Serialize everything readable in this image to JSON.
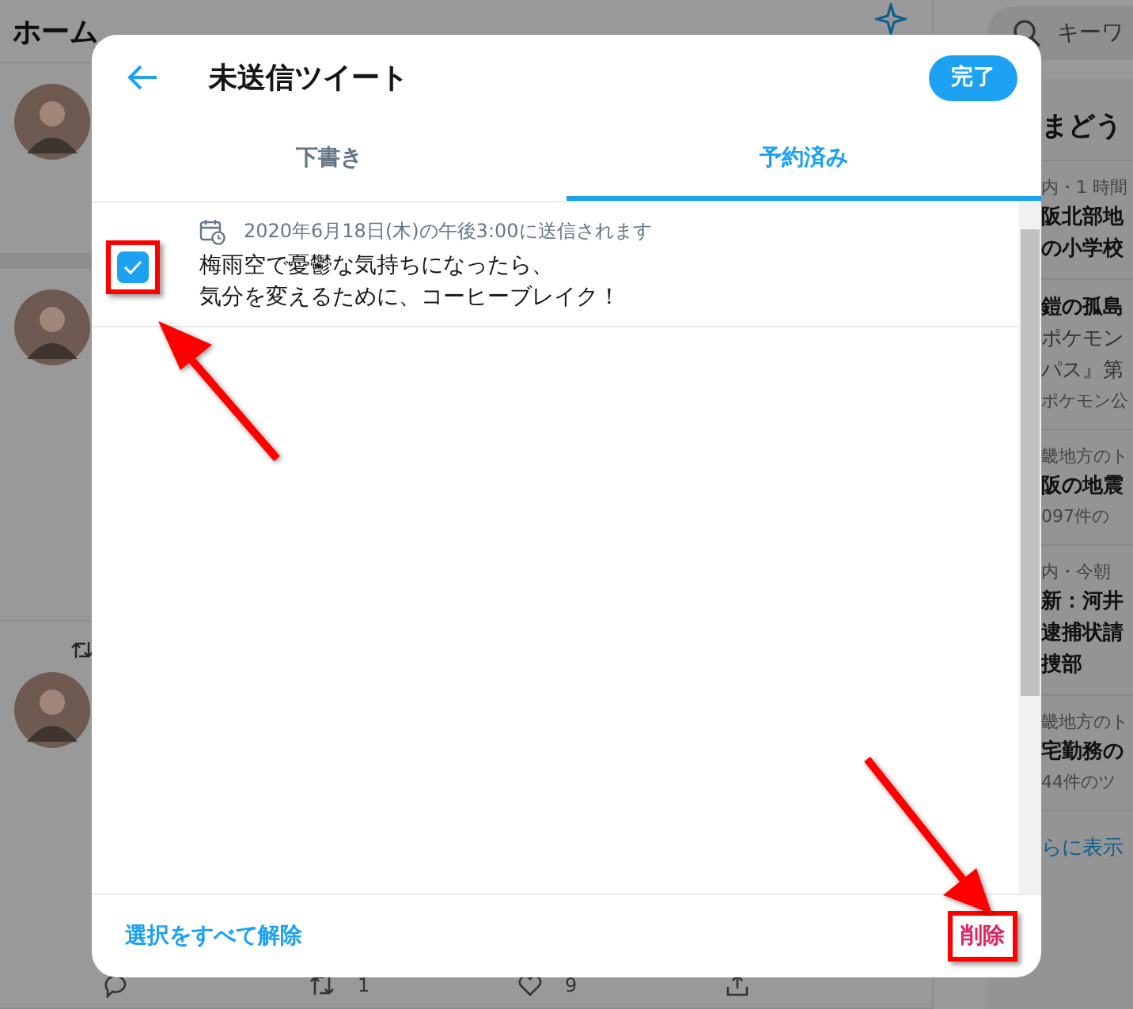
{
  "home": {
    "title": "ホーム"
  },
  "timeline": [
    {
      "retweeted": false
    },
    {
      "retweeted": false
    },
    {
      "retweeted": true,
      "actions": [
        {
          "kind": "reply"
        },
        {
          "kind": "retweet",
          "count": "1"
        },
        {
          "kind": "like",
          "count": "9"
        },
        {
          "kind": "share"
        }
      ]
    }
  ],
  "search": {
    "placeholder": "キーワ"
  },
  "trends": {
    "title": "まどう",
    "items": [
      {
        "context": "内・1 時間",
        "headline": [
          "阪北部地",
          "の小学校"
        ]
      },
      {
        "headline": [
          "鎧の孤島"
        ],
        "description": [
          "ポケモン",
          "パス』第"
        ],
        "footer": "ポケモン公"
      },
      {
        "context": "畿地方のト",
        "headline": [
          "阪の地震"
        ],
        "footer": "097件の"
      },
      {
        "context": "内・今朝",
        "headline": [
          "新：河井",
          "逮捕状請",
          "捜部"
        ]
      },
      {
        "context": "畿地方のト",
        "headline": [
          "宅勤務の"
        ],
        "footer": "44件のツ"
      }
    ],
    "more": "らに表示"
  },
  "dialog": {
    "title": "未送信ツイート",
    "done": "完了",
    "tabs": [
      {
        "label": "下書き",
        "selected": false
      },
      {
        "label": "予約済み",
        "selected": true
      }
    ],
    "scheduled": [
      {
        "checked": true,
        "highlighted": true,
        "schedule": "2020年6月18日(木)の午後3:00に送信されます",
        "lines": [
          "梅雨空で憂鬱な気持ちになったら、",
          "気分を変えるために、コーヒーブレイク！"
        ]
      }
    ],
    "footer": {
      "clear_selection": "選択をすべて解除",
      "delete": {
        "label": "削除",
        "highlighted": true
      }
    }
  }
}
